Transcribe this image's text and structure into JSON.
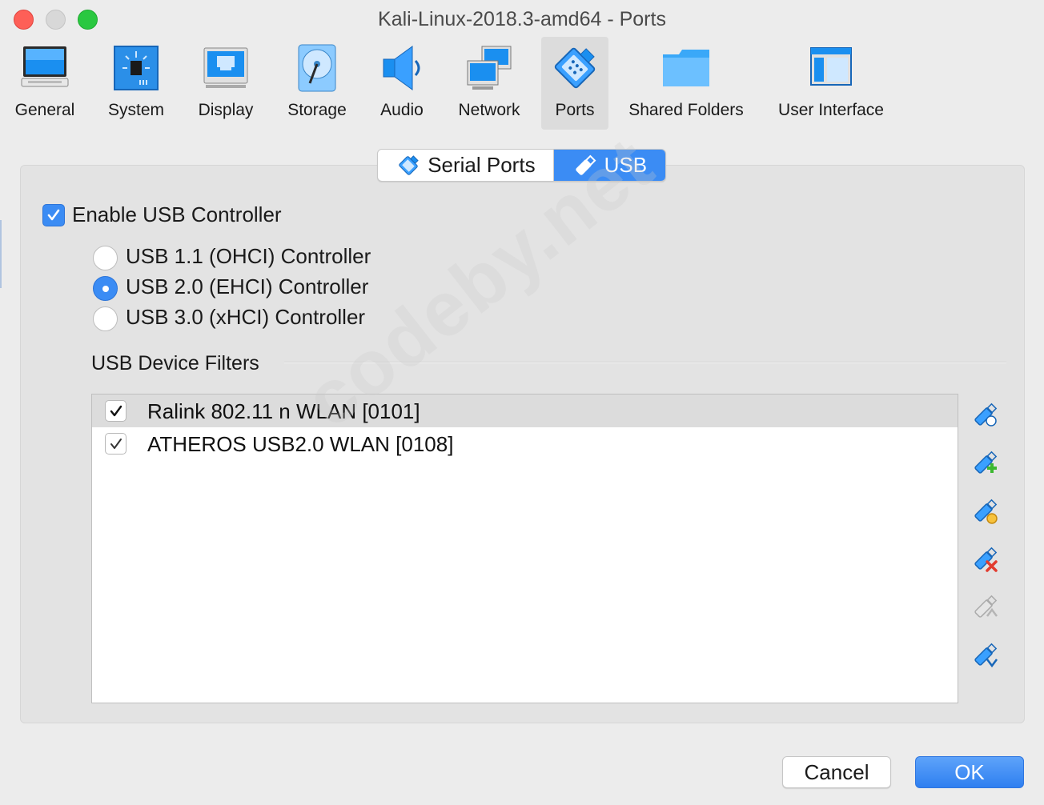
{
  "window": {
    "title": "Kali-Linux-2018.3-amd64 - Ports"
  },
  "toolbar": {
    "items": [
      {
        "label": "General",
        "icon": "monitor-icon"
      },
      {
        "label": "System",
        "icon": "chip-icon"
      },
      {
        "label": "Display",
        "icon": "display-icon"
      },
      {
        "label": "Storage",
        "icon": "disk-icon"
      },
      {
        "label": "Audio",
        "icon": "speaker-icon"
      },
      {
        "label": "Network",
        "icon": "network-icon"
      },
      {
        "label": "Ports",
        "icon": "serial-port-icon",
        "selected": true
      },
      {
        "label": "Shared Folders",
        "icon": "folder-icon"
      },
      {
        "label": "User Interface",
        "icon": "window-icon"
      }
    ]
  },
  "tabs": {
    "serial": "Serial Ports",
    "usb": "USB",
    "active": "USB"
  },
  "usb": {
    "enable_label": "Enable USB Controller",
    "enabled": true,
    "controllers": [
      {
        "label": "USB 1.1 (OHCI) Controller",
        "selected": false
      },
      {
        "label": "USB 2.0 (EHCI) Controller",
        "selected": true
      },
      {
        "label": "USB 3.0 (xHCI) Controller",
        "selected": false
      }
    ],
    "filters_title": "USB Device Filters",
    "filters": [
      {
        "label": "Ralink 802.11 n WLAN [0101]",
        "checked": true,
        "selected": true
      },
      {
        "label": "ATHEROS USB2.0 WLAN [0108]",
        "checked": true,
        "selected": false
      }
    ],
    "side_buttons": [
      "usb-filter-add-empty-icon",
      "usb-filter-add-from-device-icon",
      "usb-filter-edit-icon",
      "usb-filter-remove-icon",
      "usb-filter-move-up-icon",
      "usb-filter-move-down-icon"
    ]
  },
  "buttons": {
    "cancel": "Cancel",
    "ok": "OK"
  },
  "watermark": "codeby.net",
  "colors": {
    "accent": "#3b8cf4",
    "close": "#fe5f57",
    "maximize": "#2ac840"
  }
}
